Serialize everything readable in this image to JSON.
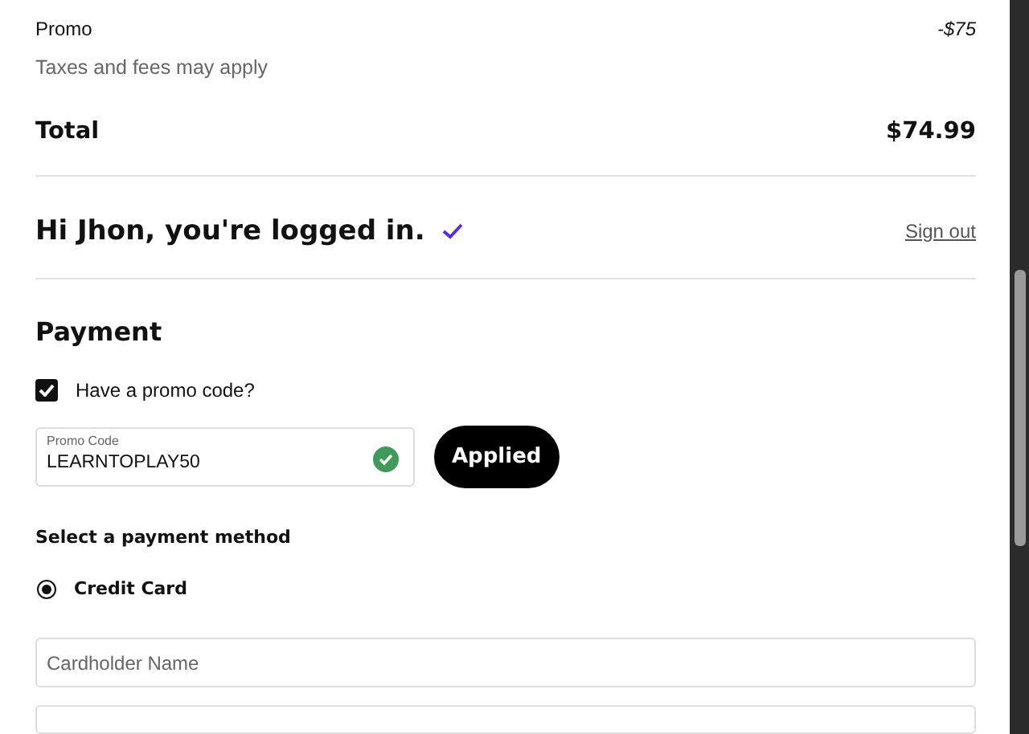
{
  "summary": {
    "promo": {
      "label": "Promo",
      "value": "-$75"
    },
    "note": "Taxes and fees may apply",
    "total": {
      "label": "Total",
      "value": "$74.99"
    }
  },
  "login": {
    "greeting": "Hi Jhon, you're logged in.",
    "verified": true,
    "sign_out": "Sign out"
  },
  "payment": {
    "title": "Payment",
    "promo_checkbox": {
      "label": "Have a promo code?",
      "checked": true
    },
    "promo_field": {
      "label": "Promo Code",
      "value": "LEARNTOPLAY50",
      "valid": true
    },
    "apply_button": "Applied",
    "method_title": "Select a payment method",
    "methods": [
      {
        "label": "Credit Card",
        "selected": true
      }
    ],
    "cardholder": {
      "placeholder": "Cardholder Name"
    }
  }
}
